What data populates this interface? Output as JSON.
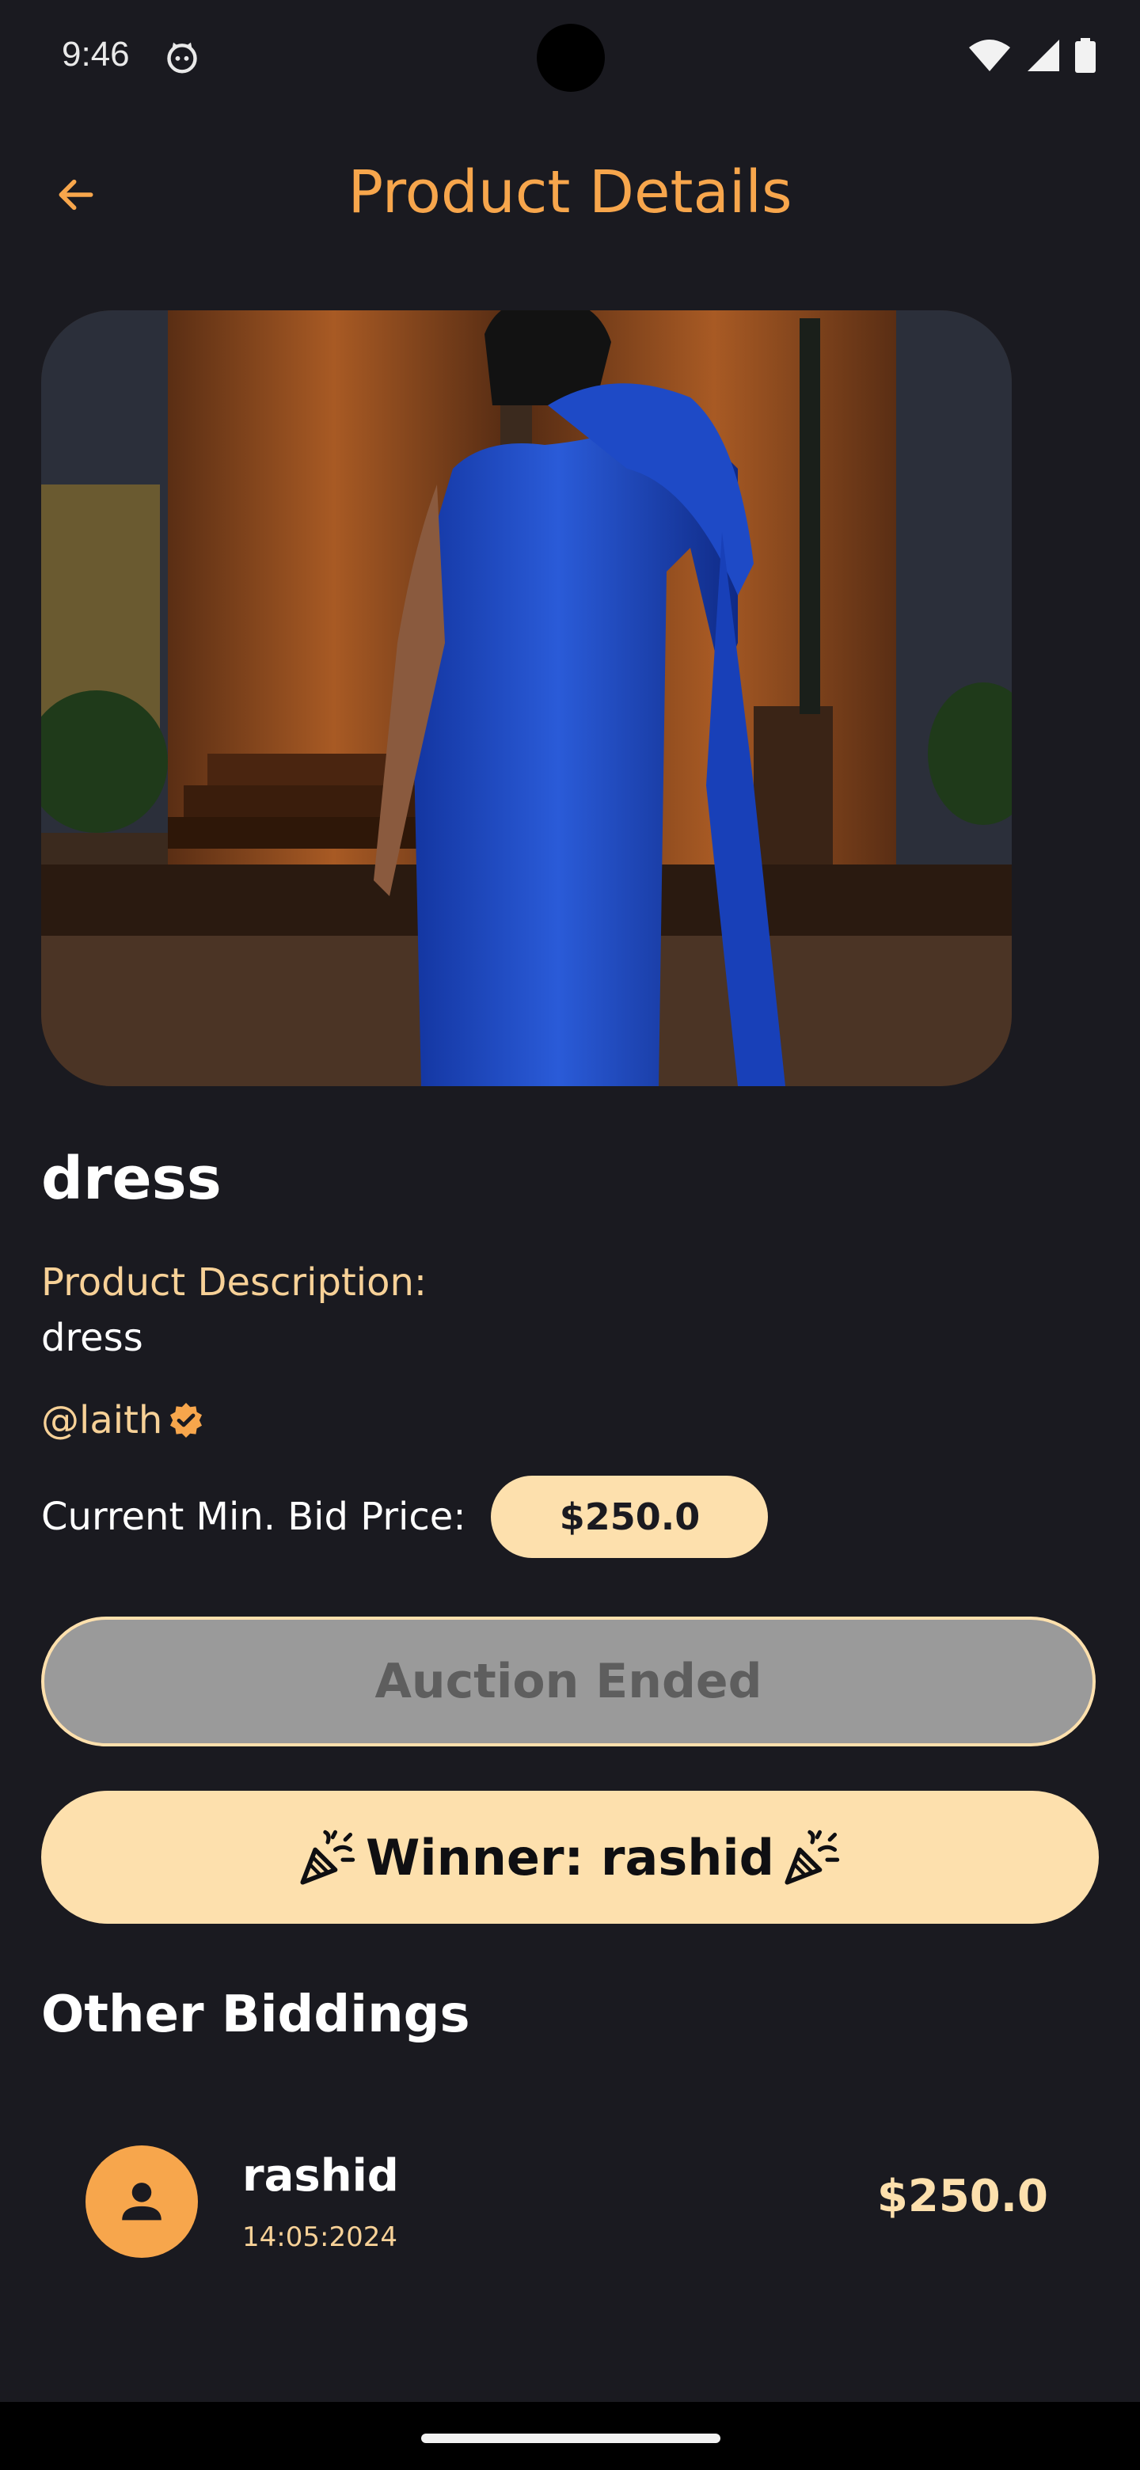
{
  "status_bar": {
    "time": "9:46",
    "icons": [
      "cat-notification-icon",
      "wifi-icon",
      "signal-icon",
      "battery-icon"
    ]
  },
  "header": {
    "title": "Product Details",
    "back_icon": "arrow-left-icon"
  },
  "colors": {
    "background": "#1a1a20",
    "accent_orange": "#f7a64c",
    "accent_cream": "#fde0ad",
    "label_cream": "#f7d197",
    "disabled_gray": "#9a9a9a"
  },
  "product": {
    "name": "dress",
    "description_label": "Product Description:",
    "description": "dress",
    "seller": "@laith",
    "seller_badge_icon": "verified-badge-icon",
    "min_bid_label": "Current Min. Bid Price:",
    "min_bid_price": "$250.0"
  },
  "auction": {
    "status_label": "Auction Ended",
    "winner_text": "Winner: rashid",
    "winner_icon": "party-popper-icon"
  },
  "other_biddings": {
    "title": "Other Biddings",
    "items": [
      {
        "name": "rashid",
        "date": "14:05:2024",
        "amount": "$250.0",
        "avatar_icon": "person-icon"
      }
    ]
  }
}
